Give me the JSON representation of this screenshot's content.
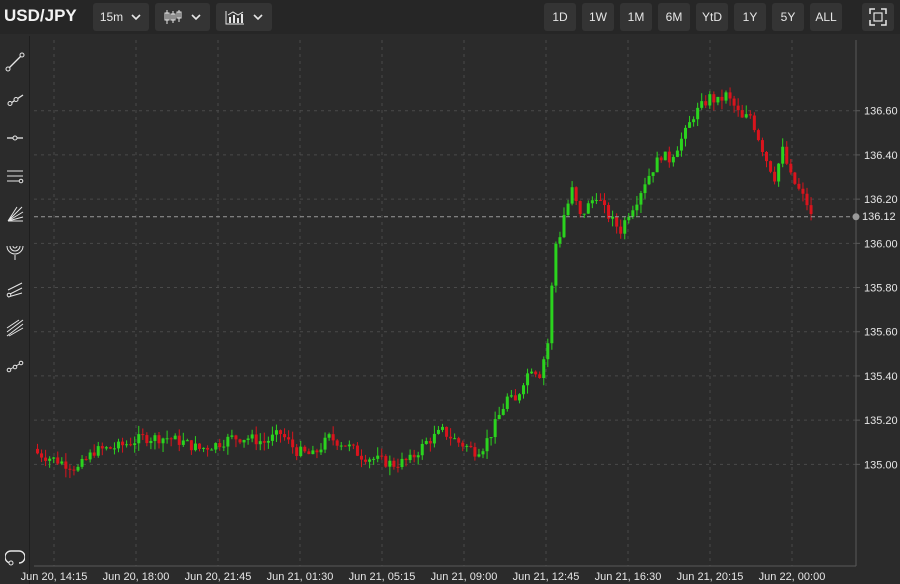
{
  "toolbar": {
    "symbol": "USD/JPY",
    "interval": "15m",
    "ranges": [
      "1D",
      "1W",
      "1M",
      "6M",
      "YtD",
      "1Y",
      "5Y",
      "ALL"
    ]
  },
  "colors": {
    "up": "#2bd31e",
    "down": "#d9141d",
    "grid": "#4a4a4a",
    "bg": "#2b2b2b"
  },
  "sidebar_icons": [
    "trend-line-icon",
    "ray-icon",
    "horizontal-line-icon",
    "parallel-channel-icon",
    "fan-icon",
    "arc-icon",
    "pitchfork-icon",
    "multi-channel-icon",
    "regression-icon",
    "magnet-icon"
  ],
  "chart_data": {
    "type": "candlestick",
    "title": "",
    "xlabel": "",
    "ylabel": "",
    "ylim": [
      134.54,
      136.92
    ],
    "yticks": [
      "136.60",
      "136.40",
      "136.20",
      "136.00",
      "135.80",
      "135.60",
      "135.40",
      "135.20",
      "135.00"
    ],
    "xticks": [
      "Jun 20, 14:15",
      "Jun 20, 18:00",
      "Jun 20, 21:45",
      "Jun 21, 01:30",
      "Jun 21, 05:15",
      "Jun 21, 09:00",
      "Jun 21, 12:45",
      "Jun 21, 16:30",
      "Jun 21, 20:15",
      "Jun 22, 00:00"
    ],
    "current_price": "136.12",
    "close_path": [
      [
        0,
        135.05
      ],
      [
        6,
        135.01
      ],
      [
        10,
        134.98
      ],
      [
        14,
        135.06
      ],
      [
        20,
        135.08
      ],
      [
        26,
        135.12
      ],
      [
        32,
        135.12
      ],
      [
        36,
        135.1
      ],
      [
        40,
        135.07
      ],
      [
        44,
        135.09
      ],
      [
        48,
        135.12
      ],
      [
        52,
        135.12
      ],
      [
        56,
        135.1
      ],
      [
        60,
        135.14
      ],
      [
        64,
        135.06
      ],
      [
        68,
        135.04
      ],
      [
        72,
        135.12
      ],
      [
        76,
        135.09
      ],
      [
        80,
        135.04
      ],
      [
        84,
        135.02
      ],
      [
        88,
        135.0
      ],
      [
        92,
        135.02
      ],
      [
        96,
        135.1
      ],
      [
        100,
        135.15
      ],
      [
        104,
        135.1
      ],
      [
        108,
        135.06
      ],
      [
        110,
        135.08
      ],
      [
        112,
        135.14
      ],
      [
        114,
        135.22
      ],
      [
        116,
        135.3
      ],
      [
        118,
        135.28
      ],
      [
        120,
        135.38
      ],
      [
        122,
        135.44
      ],
      [
        124,
        135.41
      ],
      [
        126,
        135.55
      ],
      [
        127,
        135.8
      ],
      [
        128,
        136.0
      ],
      [
        129,
        136.04
      ],
      [
        130,
        136.13
      ],
      [
        131,
        136.18
      ],
      [
        132,
        136.24
      ],
      [
        134,
        136.12
      ],
      [
        136,
        136.17
      ],
      [
        138,
        136.22
      ],
      [
        140,
        136.15
      ],
      [
        142,
        136.1
      ],
      [
        144,
        136.06
      ],
      [
        146,
        136.14
      ],
      [
        148,
        136.2
      ],
      [
        150,
        136.28
      ],
      [
        152,
        136.34
      ],
      [
        154,
        136.4
      ],
      [
        156,
        136.38
      ],
      [
        158,
        136.44
      ],
      [
        160,
        136.5
      ],
      [
        162,
        136.58
      ],
      [
        164,
        136.62
      ],
      [
        166,
        136.66
      ],
      [
        168,
        136.64
      ],
      [
        170,
        136.67
      ],
      [
        172,
        136.62
      ],
      [
        174,
        136.56
      ],
      [
        176,
        136.58
      ],
      [
        178,
        136.48
      ],
      [
        180,
        136.38
      ],
      [
        182,
        136.3
      ],
      [
        184,
        136.42
      ],
      [
        186,
        136.3
      ],
      [
        188,
        136.24
      ],
      [
        190,
        136.18
      ],
      [
        191,
        136.12
      ]
    ]
  }
}
